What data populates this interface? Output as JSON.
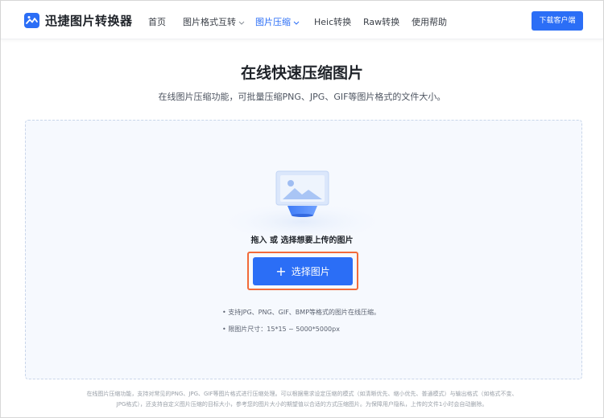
{
  "header": {
    "logo_text": "迅捷图片转换器",
    "nav": [
      {
        "label": "首页"
      },
      {
        "label": "图片格式互转"
      },
      {
        "label": "图片压缩"
      },
      {
        "label": "Heic转换"
      },
      {
        "label": "Raw转换"
      },
      {
        "label": "使用帮助"
      }
    ],
    "download_label": "下载客户端"
  },
  "main": {
    "title": "在线快速压缩图片",
    "subtitle": "在线图片压缩功能，可批量压缩PNG、JPG、GIF等图片格式的文件大小。",
    "drop_text": "拖入 或 选择想要上传的图片",
    "select_label": "选择图片",
    "notes": [
      "• 支持JPG、PNG、GIF、BMP等格式的图片在线压缩。",
      "• 限图片尺寸：15*15 ~ 5000*5000px"
    ]
  },
  "footer": {
    "line1": "在线图片压缩功能，支持对常见的PNG、JPG、GIF等图片格式进行压缩处理。可以根据需求设定压缩的模式（如清晰优先、缩小优先、普通模式）与输出格式（如格式不变、",
    "line2": "JPG格式），还支持自定义图片压缩的目标大小，参考您的图片大小的期望值以合适的方式压缩图片。为保障用户隐私，上传的文件1小时会自动删除。"
  },
  "colors": {
    "accent": "#2b6ef6",
    "highlight": "#f26b3a"
  }
}
